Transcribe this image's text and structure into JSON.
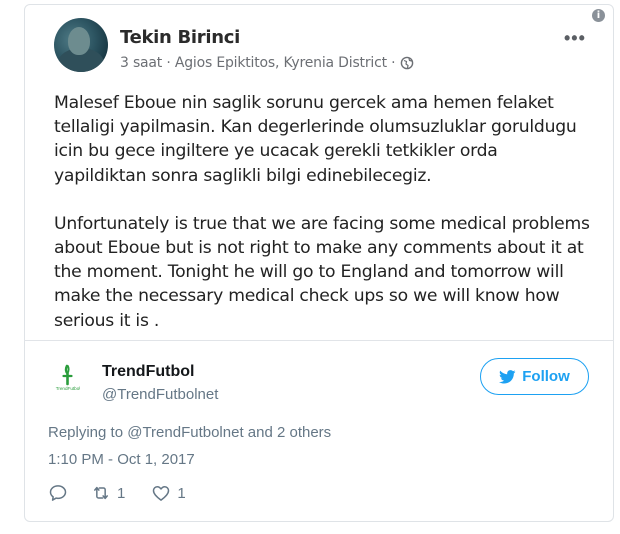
{
  "facebook_post": {
    "author": "Tekin Birinci",
    "meta": "3 saat · Agios Epiktitos, Kyrenia District ·",
    "more_label": "•••",
    "paragraphs": [
      "Malesef Eboue  nin saglik sorunu gercek ama hemen felaket tellaligi yapilmasin. Kan degerlerinde olumsuzluklar goruldugu icin bu gece ingiltere ye ucacak gerekli tetkikler orda yapildiktan sonra saglikli bilgi edinebilecegiz.",
      "Unfortunately is true that we are facing some  medical problems about Eboue  but is not right to make any comments about it at the moment. Tonight he will go to England and tomorrow will make the necessary medical check ups so we will know how serious it is ."
    ]
  },
  "tweet": {
    "display_name": "TrendFutbol",
    "handle": "@TrendFutbolnet",
    "avatar_logo_text": "TrendFutbol",
    "follow_label": "Follow",
    "reply_context": "Replying to @TrendFutbolnet and 2 others",
    "timestamp": "1:10 PM - Oct 1, 2017",
    "retweet_count": "1",
    "like_count": "1"
  },
  "info_label": "i",
  "colors": {
    "twitter_blue": "#1da1f2",
    "muted_text": "#657786",
    "logo_green": "#2a9d3c"
  },
  "icons": [
    "info-icon",
    "globe-icon",
    "more-icon",
    "twitter-bird-icon",
    "reply-icon",
    "retweet-icon",
    "heart-icon"
  ]
}
